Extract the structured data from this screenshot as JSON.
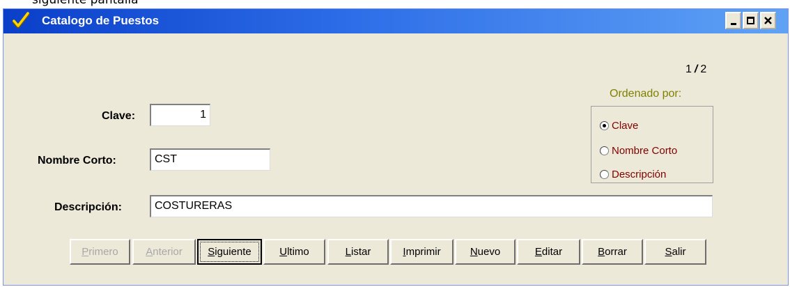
{
  "document": {
    "caption": "siguiente pantalla"
  },
  "window": {
    "title": "Catalogo de Puestos",
    "controls": {
      "minimize": "_",
      "maximize": "□",
      "close": "✕"
    }
  },
  "pagination": {
    "current": "1",
    "separator": "/",
    "total": "2"
  },
  "fields": {
    "clave": {
      "label": "Clave:",
      "value": "1"
    },
    "nombre_corto": {
      "label": "Nombre Corto:",
      "value": "CST"
    },
    "descripcion": {
      "label": "Descripción:",
      "value": "COSTURERAS"
    }
  },
  "sort": {
    "title": "Ordenado por:",
    "options": [
      {
        "label": "Clave",
        "selected": true
      },
      {
        "label": "Nombre Corto",
        "selected": false
      },
      {
        "label": "Descripción",
        "selected": false
      }
    ]
  },
  "buttons": [
    {
      "first": "P",
      "rest": "rimero",
      "enabled": false
    },
    {
      "first": "A",
      "rest": "nterior",
      "enabled": false
    },
    {
      "first": "S",
      "rest": "iguiente",
      "enabled": true,
      "focused": true
    },
    {
      "first": "U",
      "rest": "ltimo",
      "enabled": true
    },
    {
      "first": "L",
      "rest": "istar",
      "enabled": true
    },
    {
      "first": "I",
      "rest": "mprimir",
      "enabled": true
    },
    {
      "first": "N",
      "rest": "uevo",
      "enabled": true
    },
    {
      "first": "E",
      "rest": "ditar",
      "enabled": true
    },
    {
      "first": "B",
      "rest": "orrar",
      "enabled": true
    },
    {
      "first": "S",
      "rest": "alir",
      "enabled": true
    }
  ],
  "icons": {
    "app": "checkmark-icon"
  },
  "colors": {
    "titlebar": "#0a3fc9",
    "window_bg": "#ece9d8",
    "sort_title": "#808000",
    "radio_label": "#800000"
  }
}
